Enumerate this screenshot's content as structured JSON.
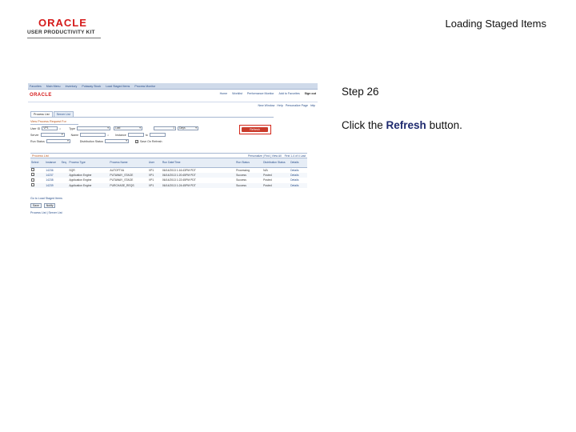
{
  "slide": {
    "logo_word": "ORACLE",
    "logo_sub": "USER PRODUCTIVITY KIT",
    "title": "Loading Staged Items",
    "step": "Step 26",
    "instruction_prefix": "Click the ",
    "instruction_highlight": "Refresh",
    "instruction_suffix": " button."
  },
  "screenshot": {
    "breadcrumbs": [
      "Favorites",
      "Main Menu",
      "Inventory",
      "Putaway Stock",
      "Load Staged Items",
      "Process Monitor"
    ],
    "logo": "ORACLE",
    "header_links": [
      "Home",
      "Worklist",
      "Performance Monitor",
      "Add to Favorites",
      "Sign out"
    ],
    "window_links": [
      "New Window",
      "Help",
      "Personalize Page",
      "http"
    ],
    "tabs": [
      "Process List",
      "Server List"
    ],
    "request_title": "View Process Request For",
    "fields": {
      "user_id_label": "User ID",
      "user_id_value": "VP1",
      "type_label": "Type",
      "last_label": "Last",
      "last_value": "1",
      "days_value": "Days",
      "server_label": "Server",
      "name_label": "Name",
      "instance_label": "Instance",
      "to_label": "to",
      "run_status_label": "Run Status",
      "dist_status_label": "Distribution Status",
      "save_on_refresh_label": "Save On Refresh"
    },
    "refresh_label": "Refresh",
    "process_list": {
      "title": "Process List",
      "nav_mid": "Personalize | Find | View All",
      "nav_right": "First 1-4 of 4 Last",
      "columns": [
        "Select",
        "Instance",
        "Seq.",
        "Process Type",
        "Process Name",
        "User",
        "Run Date/Time",
        "Run Status",
        "Distribution Status",
        "Details"
      ],
      "rows": [
        [
          "",
          "14236",
          "",
          "SQR",
          "AUTOFTVA",
          "VP1",
          "06/14/2013 1:16:43PM PDT",
          "Processing",
          "N/A",
          "Details"
        ],
        [
          "",
          "14237",
          "",
          "Application Engine",
          "PUTAWAY_STAGE",
          "VP1",
          "06/14/2013 1:20:45PM PDT",
          "Success",
          "Posted",
          "Details"
        ],
        [
          "",
          "14238",
          "",
          "Application Engine",
          "PUTAWAY_STAGE",
          "VP1",
          "06/14/2013 1:22:45PM PDT",
          "Success",
          "Posted",
          "Details"
        ],
        [
          "",
          "14239",
          "",
          "Application Engine",
          "PURCHASE_REQS",
          "VP1",
          "06/14/2013 1:24:45PM PDT",
          "Success",
          "Posted",
          "Details"
        ]
      ]
    },
    "below_link": "Go to Load Staged Items",
    "save_btn": "Save",
    "notify_btn": "Notify",
    "go_back": "Process List | Server List"
  },
  "colors": {
    "oracle_red": "#d51a1a",
    "highlight_box": "#d4281c",
    "link_blue": "#2a4f8a",
    "instruction_blue": "#1e2a6e"
  }
}
